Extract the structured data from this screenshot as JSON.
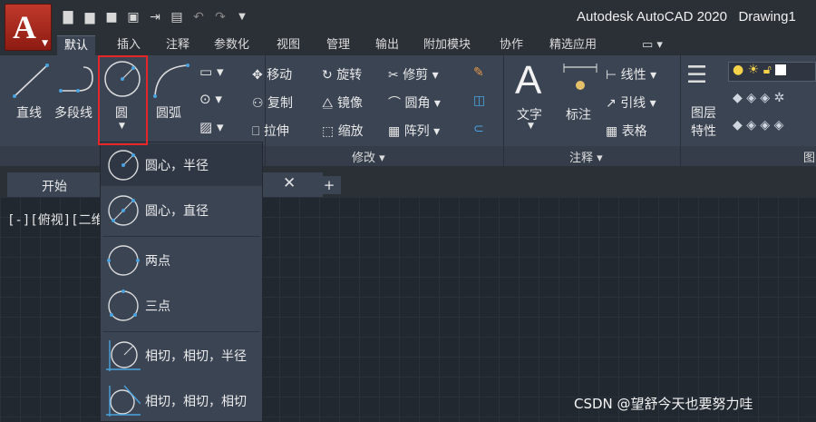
{
  "app": {
    "logo_letter": "A",
    "title": "Autodesk AutoCAD 2020",
    "drawing": "Drawing1"
  },
  "quick_access": [
    "new-icon",
    "open-icon",
    "save-icon",
    "save-as-icon",
    "export-icon",
    "print-icon",
    "undo-icon",
    "redo-icon",
    "customize-icon"
  ],
  "tabs": [
    {
      "label": "默认",
      "active": true
    },
    {
      "label": "插入"
    },
    {
      "label": "注释"
    },
    {
      "label": "参数化"
    },
    {
      "label": "视图"
    },
    {
      "label": "管理"
    },
    {
      "label": "输出"
    },
    {
      "label": "附加模块"
    },
    {
      "label": "协作"
    },
    {
      "label": "精选应用"
    }
  ],
  "draw_panel": {
    "line": "直线",
    "polyline": "多段线",
    "circle": "圆",
    "arc": "圆弧"
  },
  "modify_panel": {
    "move": "移动",
    "rotate": "旋转",
    "trim": "修剪",
    "copy": "复制",
    "mirror": "镜像",
    "fillet": "圆角",
    "stretch": "拉伸",
    "scale": "缩放",
    "array": "阵列",
    "label": "修改"
  },
  "annotation_panel": {
    "text": "文字",
    "dimension": "标注",
    "linear": "线性",
    "leader": "引线",
    "table": "表格",
    "label": "注释"
  },
  "layers_panel": {
    "layer_props_1": "图层",
    "layer_props_2": "特性",
    "label_partial": "图"
  },
  "file_tab": {
    "label": "开始",
    "close": "✕",
    "plus": "+"
  },
  "canvas": {
    "viewport_label": "[-][俯视][二维线"
  },
  "circle_menu": [
    {
      "label": "圆心，半径",
      "selected": true
    },
    {
      "label": "圆心，直径"
    },
    {
      "label": "两点"
    },
    {
      "label": "三点"
    },
    {
      "label": "相切，相切，半径"
    },
    {
      "label": "相切，相切，相切"
    }
  ],
  "watermark": "CSDN @望舒今天也要努力哇",
  "colors": {
    "accent_red": "#e8262a",
    "icon_blue": "#4aa3df",
    "ribbon_bg": "#3b4453"
  }
}
